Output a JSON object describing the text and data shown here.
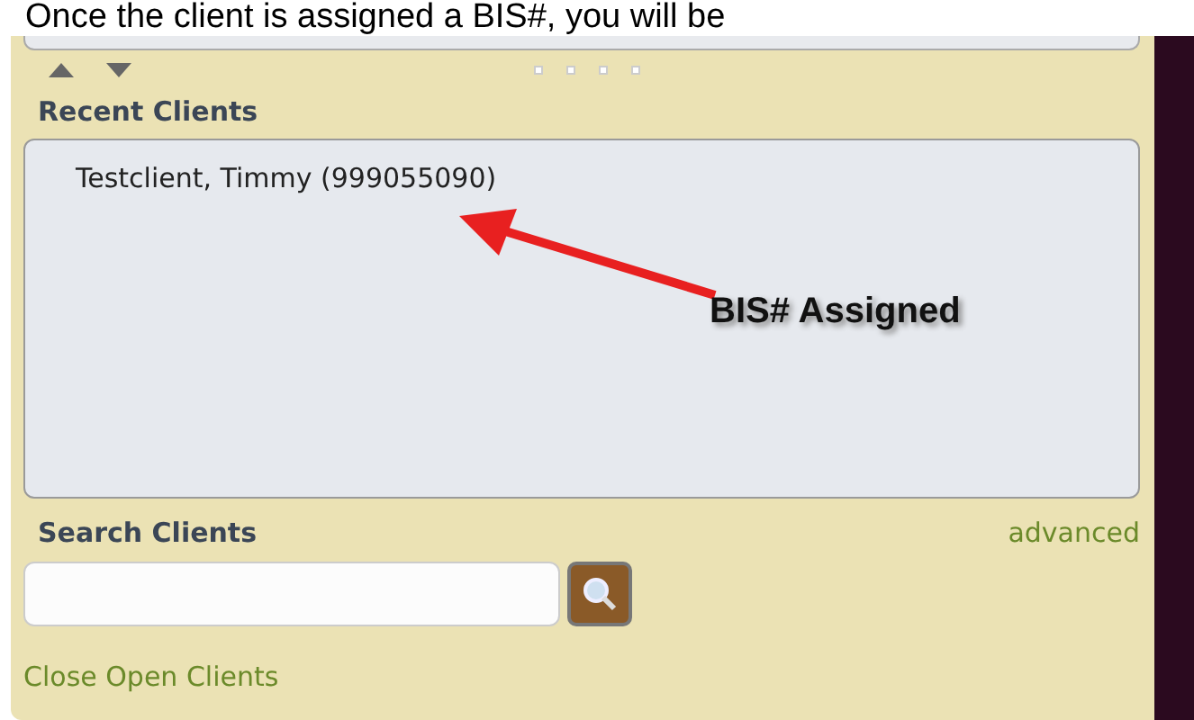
{
  "caption": "Once the client is assigned a BIS#, you will be",
  "recent_clients": {
    "title": "Recent Clients",
    "items": [
      {
        "label": "Testclient, Timmy (999055090)"
      }
    ]
  },
  "annotation": {
    "text": "BIS# Assigned"
  },
  "search": {
    "title": "Search Clients",
    "advanced_link": "advanced"
  },
  "close_link": "Close Open Clients"
}
